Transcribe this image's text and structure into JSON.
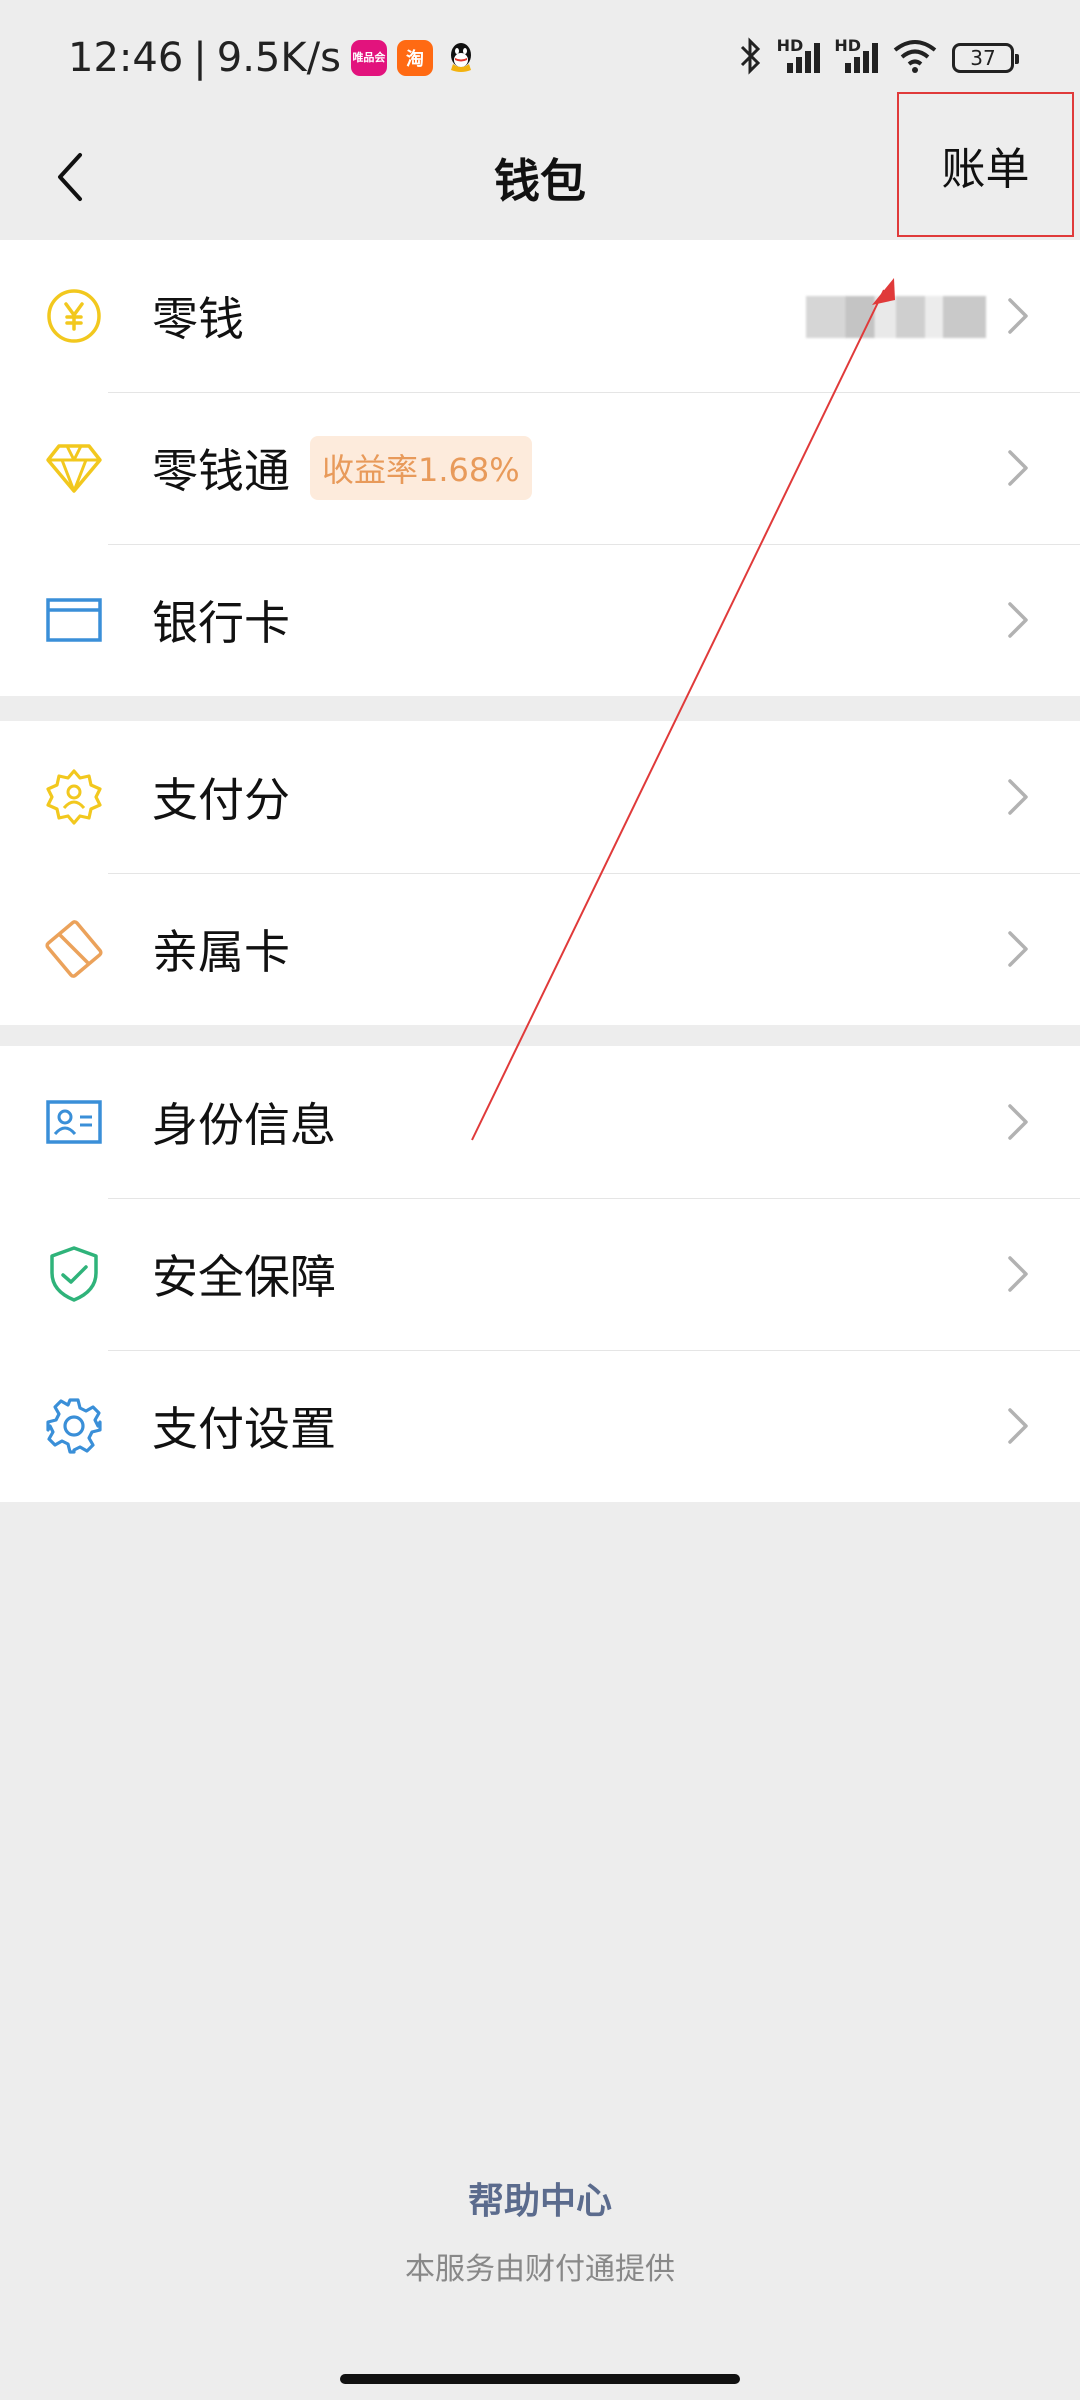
{
  "status_bar": {
    "time": "12:46",
    "separator": "|",
    "network_speed": "9.5K/s",
    "app_icons": [
      "唯品会",
      "淘",
      "qq"
    ],
    "hd1": "HD",
    "hd2": "HD",
    "battery": "37"
  },
  "header": {
    "title": "钱包",
    "bill_label": "账单"
  },
  "group1": [
    {
      "label": "零钱",
      "icon": "yuan-coin-icon"
    },
    {
      "label": "零钱通",
      "icon": "diamond-icon",
      "badge": "收益率1.68%"
    },
    {
      "label": "银行卡",
      "icon": "bank-card-icon"
    }
  ],
  "group2": [
    {
      "label": "支付分",
      "icon": "credit-score-icon"
    },
    {
      "label": "亲属卡",
      "icon": "family-card-icon"
    }
  ],
  "group3": [
    {
      "label": "身份信息",
      "icon": "id-card-icon"
    },
    {
      "label": "安全保障",
      "icon": "shield-check-icon"
    },
    {
      "label": "支付设置",
      "icon": "gear-icon"
    }
  ],
  "footer": {
    "help": "帮助中心",
    "provider": "本服务由财付通提供"
  },
  "colors": {
    "accent_yellow": "#f2c81e",
    "accent_blue": "#3a8fd8",
    "accent_green": "#2fb37a",
    "accent_orange": "#eba25b",
    "annotation_red": "#e03a3a"
  }
}
